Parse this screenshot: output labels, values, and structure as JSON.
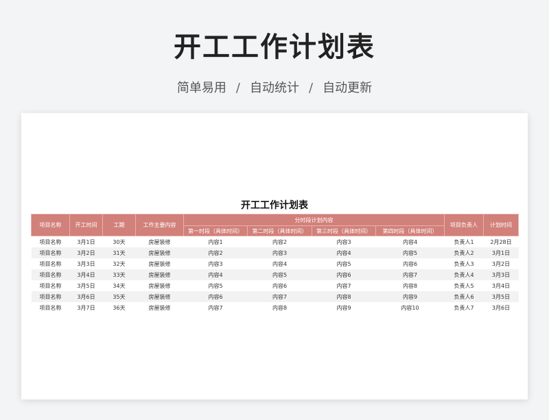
{
  "header": {
    "title": "开工工作计划表",
    "subtitle_parts": [
      "简单易用",
      "自动统计",
      "自动更新"
    ],
    "separator": "/"
  },
  "sheet": {
    "title": "开工工作计划表",
    "headers": {
      "project_name": "项目名称",
      "start_time": "开工时间",
      "duration": "工期",
      "main_content": "工作主要内容",
      "phase_group": "分时段计划内容",
      "phase1": "第一时段（具体时间）",
      "phase2": "第二时段（具体时间）",
      "phase3": "第三时段（具体时间）",
      "phase4": "第四时段（具体时间）",
      "owner": "项目负责人",
      "plan_time": "计划时间"
    },
    "rows": [
      [
        "项目名称",
        "3月1日",
        "30天",
        "房屋装修",
        "内容1",
        "内容2",
        "内容3",
        "内容4",
        "负责人1",
        "2月28日"
      ],
      [
        "项目名称",
        "3月2日",
        "31天",
        "房屋装修",
        "内容2",
        "内容3",
        "内容4",
        "内容5",
        "负责人2",
        "3月1日"
      ],
      [
        "项目名称",
        "3月3日",
        "32天",
        "房屋装修",
        "内容3",
        "内容4",
        "内容5",
        "内容6",
        "负责人3",
        "3月2日"
      ],
      [
        "项目名称",
        "3月4日",
        "33天",
        "房屋装修",
        "内容4",
        "内容5",
        "内容6",
        "内容7",
        "负责人4",
        "3月3日"
      ],
      [
        "项目名称",
        "3月5日",
        "34天",
        "房屋装修",
        "内容5",
        "内容6",
        "内容7",
        "内容8",
        "负责人5",
        "3月4日"
      ],
      [
        "项目名称",
        "3月6日",
        "35天",
        "房屋装修",
        "内容6",
        "内容7",
        "内容8",
        "内容9",
        "负责人6",
        "3月5日"
      ],
      [
        "项目名称",
        "3月7日",
        "36天",
        "房屋装修",
        "内容7",
        "内容8",
        "内容9",
        "内容10",
        "负责人7",
        "3月6日"
      ]
    ]
  },
  "colors": {
    "header_bg": "#d2807a",
    "stripe": "#f2f2f2",
    "page_bg": "#f3f4f6"
  }
}
